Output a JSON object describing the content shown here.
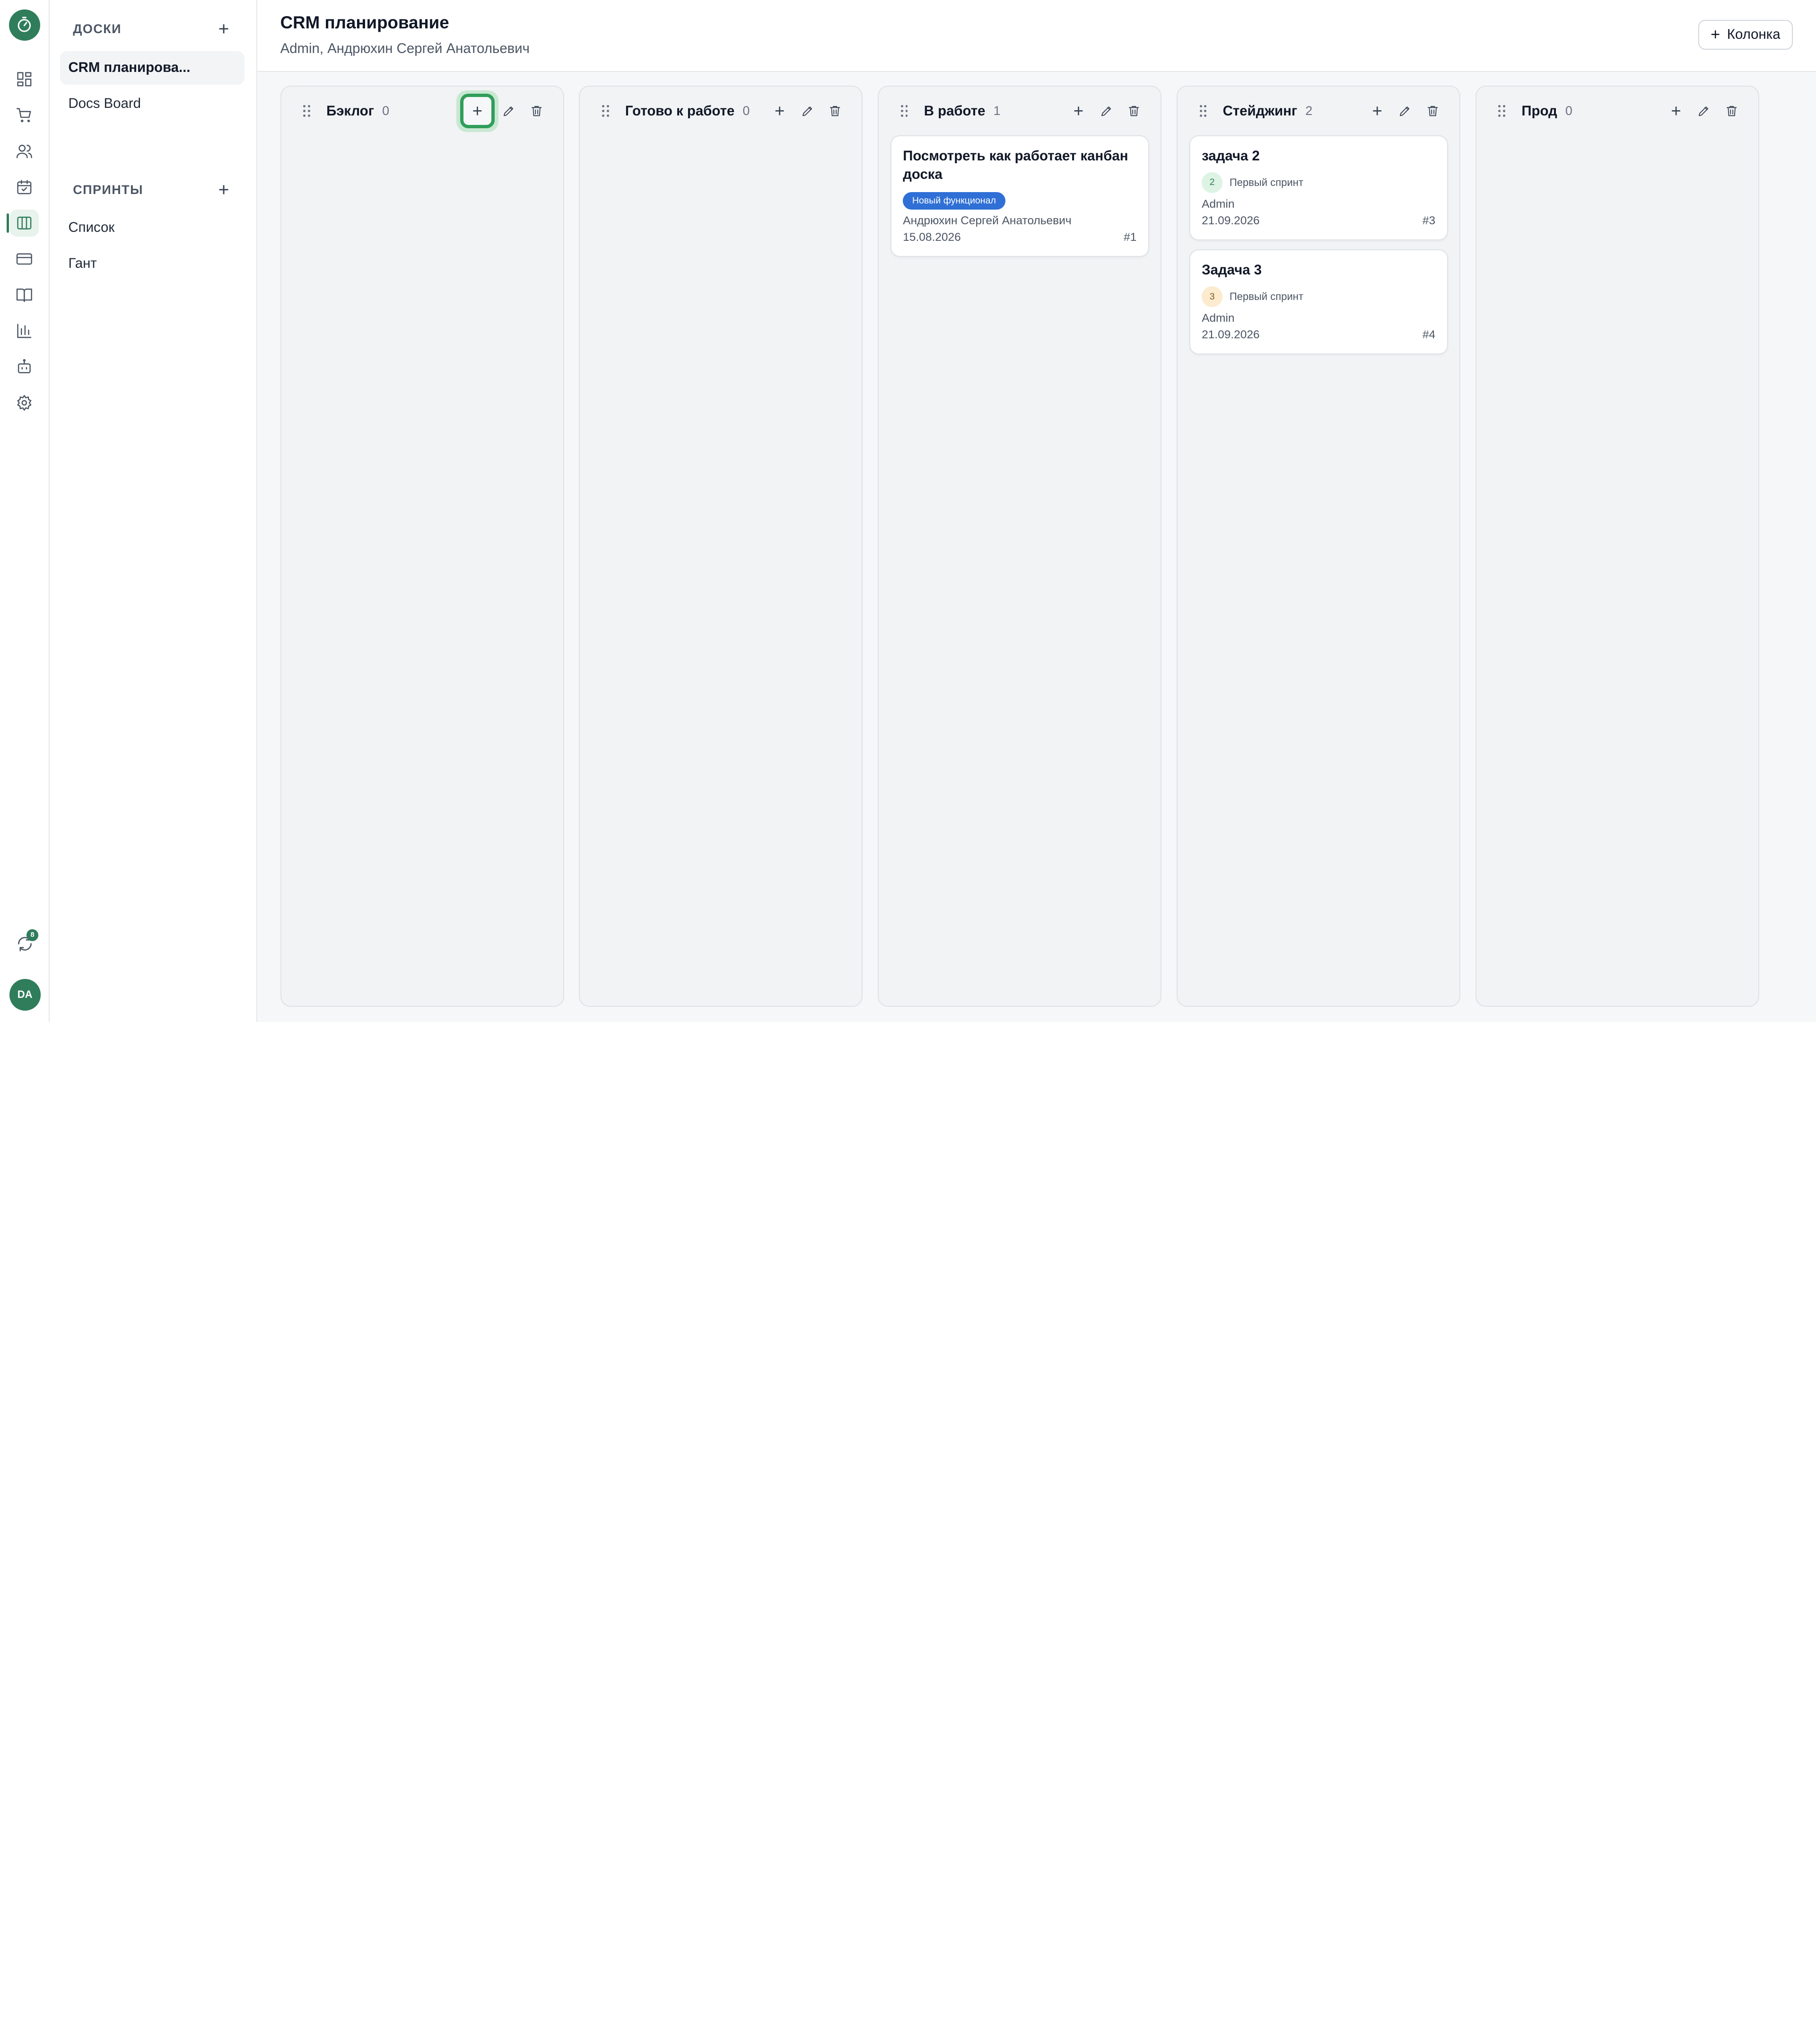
{
  "rail": {
    "items": [
      {
        "name": "dashboard-icon"
      },
      {
        "name": "cart-icon"
      },
      {
        "name": "users-icon"
      },
      {
        "name": "calendar-check-icon"
      },
      {
        "name": "kanban-icon",
        "active": true
      },
      {
        "name": "credit-card-icon"
      },
      {
        "name": "book-icon"
      },
      {
        "name": "bar-chart-icon"
      },
      {
        "name": "bot-icon"
      },
      {
        "name": "settings-icon"
      }
    ],
    "sync_badge": "8",
    "avatar": "DA"
  },
  "sidebar": {
    "boards_heading": "ДОСКИ",
    "boards": [
      {
        "label": "CRM планирова..."
      },
      {
        "label": "Docs Board"
      }
    ],
    "sprints_heading": "СПРИНТЫ",
    "sprints": [
      {
        "label": "Список"
      },
      {
        "label": "Гант"
      }
    ]
  },
  "header": {
    "title": "CRM планирование",
    "subtitle": "Admin, Андрюхин Сергей Анатольевич",
    "add_column_label": "Колонка"
  },
  "columns": [
    {
      "title": "Бэклог",
      "count": "0",
      "cards": []
    },
    {
      "title": "Готово к работе",
      "count": "0",
      "cards": []
    },
    {
      "title": "В работе",
      "count": "1",
      "cards": [
        {
          "title": "Посмотреть как работает канбан доска",
          "tag": "Новый функционал",
          "assignee": "Андрюхин Сергей Анатольевич",
          "date": "15.08.2026",
          "id": "#1"
        }
      ]
    },
    {
      "title": "Стейджинг",
      "count": "2",
      "cards": [
        {
          "title": "задача 2",
          "points": "2",
          "sprint": "Первый спринт",
          "assignee": "Admin",
          "date": "21.09.2026",
          "id": "#3"
        },
        {
          "title": "Задача 3",
          "points": "3",
          "sprint": "Первый спринт",
          "assignee": "Admin",
          "date": "21.09.2026",
          "id": "#4"
        }
      ]
    },
    {
      "title": "Прод",
      "count": "0",
      "cards": []
    }
  ],
  "colors": {
    "brand": "#2f7d5b",
    "tag_blue": "#2f6fd6",
    "focus_ring": "#2f9e5a"
  }
}
